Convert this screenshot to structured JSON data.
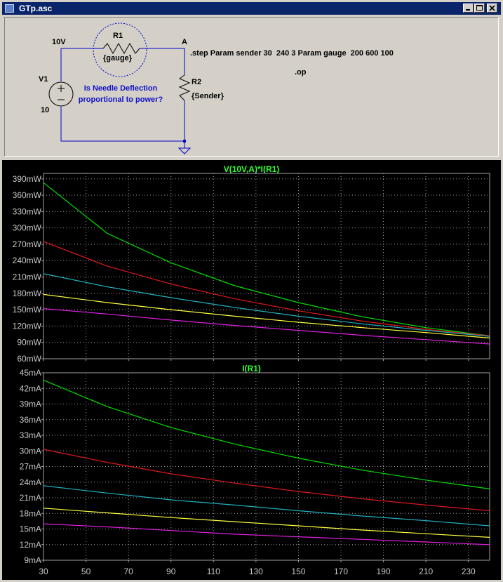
{
  "window": {
    "title": "GTp.asc"
  },
  "schematic": {
    "node_10v": "10V",
    "node_a": "A",
    "r1_name": "R1",
    "r1_value": "{gauge}",
    "r2_name": "R2",
    "r2_value": "{Sender}",
    "v1_name": "V1",
    "v1_value": "10",
    "comment_line1": "Is Needle Deflection",
    "comment_line2": "proportional to power?",
    "directive_step": ".step Param sender 30  240 3 Param gauge  200 600 100",
    "directive_op": ".op"
  },
  "colors": {
    "trace_green": "#00e000",
    "trace_red": "#e01818",
    "trace_cyan": "#20b0c0",
    "trace_yellow": "#ffff40",
    "trace_magenta": "#e020e0",
    "plot_title": "#30ff30",
    "comment": "#1010c8"
  },
  "chart_data": [
    {
      "type": "line",
      "title": "V(10V,A)*I(R1)",
      "x_ticks": [
        "30",
        "50",
        "70",
        "90",
        "110",
        "130",
        "150",
        "170",
        "190",
        "210",
        "230"
      ],
      "y_ticks": [
        "60mW",
        "90mW",
        "120mW",
        "150mW",
        "180mW",
        "210mW",
        "240mW",
        "270mW",
        "300mW",
        "330mW",
        "360mW",
        "390mW"
      ],
      "xlim": [
        30,
        240
      ],
      "ylim": [
        60,
        400
      ],
      "grid": true,
      "series": [
        {
          "color": "#00e000",
          "x": [
            30,
            60,
            90,
            120,
            150,
            180,
            210,
            240
          ],
          "values": [
            383,
            290,
            236,
            194,
            163,
            137,
            117,
            102
          ]
        },
        {
          "color": "#e01818",
          "x": [
            30,
            60,
            90,
            120,
            150,
            180,
            210,
            240
          ],
          "values": [
            275,
            230,
            197,
            170,
            148,
            129,
            114,
            102
          ]
        },
        {
          "color": "#20b0c0",
          "x": [
            30,
            60,
            90,
            120,
            150,
            180,
            210,
            240
          ],
          "values": [
            216,
            192,
            172,
            154,
            138,
            124,
            112,
            101
          ]
        },
        {
          "color": "#ffff40",
          "x": [
            30,
            60,
            90,
            120,
            150,
            180,
            210,
            240
          ],
          "values": [
            178,
            163,
            150,
            138,
            127,
            117,
            108,
            98
          ]
        },
        {
          "color": "#e020e0",
          "x": [
            30,
            60,
            90,
            120,
            150,
            180,
            210,
            240
          ],
          "values": [
            152,
            142,
            131,
            121,
            112,
            103,
            95,
            87
          ]
        }
      ]
    },
    {
      "type": "line",
      "title": "I(R1)",
      "x_ticks": [
        "30",
        "50",
        "70",
        "90",
        "110",
        "130",
        "150",
        "170",
        "190",
        "210",
        "230"
      ],
      "y_ticks": [
        "9mA",
        "12mA",
        "15mA",
        "18mA",
        "21mA",
        "24mA",
        "27mA",
        "30mA",
        "33mA",
        "36mA",
        "39mA",
        "42mA",
        "45mA"
      ],
      "xlim": [
        30,
        240
      ],
      "ylim": [
        9,
        45
      ],
      "grid": true,
      "series": [
        {
          "color": "#00e000",
          "x": [
            30,
            60,
            90,
            120,
            150,
            180,
            210,
            240
          ],
          "values": [
            43.6,
            38.5,
            34.5,
            31.3,
            28.6,
            26.3,
            24.4,
            22.7
          ]
        },
        {
          "color": "#e01818",
          "x": [
            30,
            60,
            90,
            120,
            150,
            180,
            210,
            240
          ],
          "values": [
            30.3,
            27.8,
            25.6,
            23.8,
            22.2,
            20.8,
            19.6,
            18.5
          ]
        },
        {
          "color": "#20b0c0",
          "x": [
            30,
            60,
            90,
            120,
            150,
            180,
            210,
            240
          ],
          "values": [
            23.3,
            21.9,
            20.6,
            19.6,
            18.5,
            17.5,
            16.6,
            15.6
          ]
        },
        {
          "color": "#ffff40",
          "x": [
            30,
            60,
            90,
            120,
            150,
            180,
            210,
            240
          ],
          "values": [
            19.0,
            18.1,
            17.2,
            16.4,
            15.6,
            14.8,
            14.1,
            13.4
          ]
        },
        {
          "color": "#e020e0",
          "x": [
            30,
            60,
            90,
            120,
            150,
            180,
            210,
            240
          ],
          "values": [
            16.0,
            15.4,
            14.7,
            14.0,
            13.5,
            13.0,
            12.5,
            12.0
          ]
        }
      ]
    }
  ]
}
